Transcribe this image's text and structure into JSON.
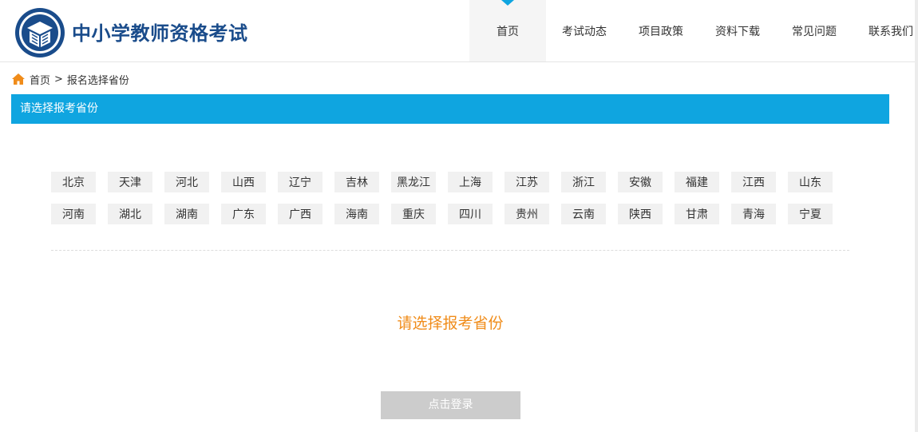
{
  "header": {
    "site_title": "中小学教师资格考试",
    "nav": [
      {
        "label": "首页",
        "active": true
      },
      {
        "label": "考试动态",
        "active": false
      },
      {
        "label": "项目政策",
        "active": false
      },
      {
        "label": "资料下载",
        "active": false
      },
      {
        "label": "常见问题",
        "active": false
      },
      {
        "label": "联系我们",
        "active": false
      }
    ]
  },
  "breadcrumb": {
    "home_icon": "home-icon",
    "home": "首页",
    "separator": ">",
    "current": "报名选择省份"
  },
  "section": {
    "title": "请选择报考省份"
  },
  "provinces": [
    [
      "北京",
      "天津",
      "河北",
      "山西",
      "辽宁",
      "吉林",
      "黑龙江",
      "上海",
      "江苏",
      "浙江",
      "安徽",
      "福建",
      "江西",
      "山东"
    ],
    [
      "河南",
      "湖北",
      "湖南",
      "广东",
      "广西",
      "海南",
      "重庆",
      "四川",
      "贵州",
      "云南",
      "陕西",
      "甘肃",
      "青海",
      "宁夏"
    ]
  ],
  "prompt": "请选择报考省份",
  "login_button": "点击登录",
  "colors": {
    "accent_blue": "#0fa5e0",
    "title_blue": "#1a4c8b",
    "prompt_orange": "#f08c1a",
    "home_icon_orange": "#f08c1a",
    "button_disabled": "#cccccc"
  }
}
